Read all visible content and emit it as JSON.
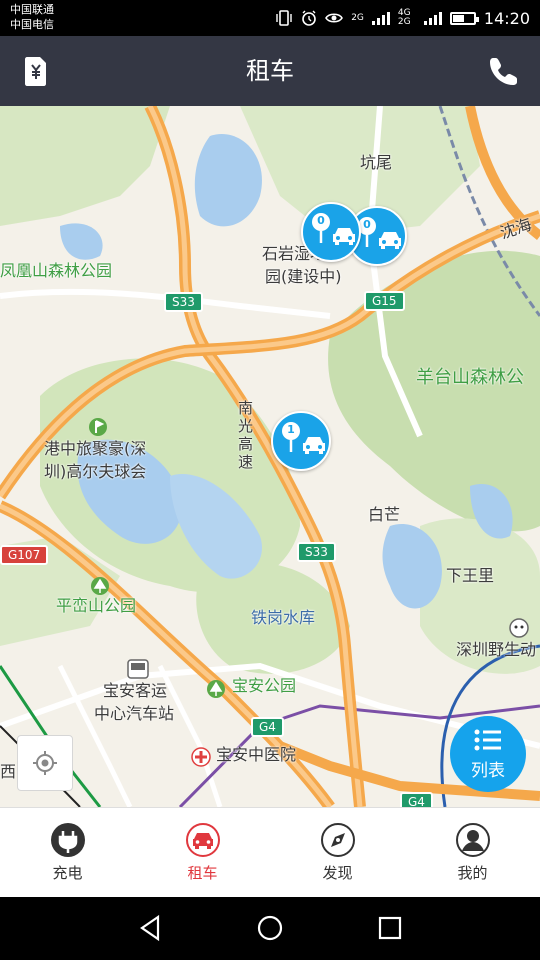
{
  "status_bar": {
    "carrier_1": "中国联通",
    "carrier_2": "中国电信",
    "network_1": "2G",
    "network_2": "4G 2G",
    "time": "14:20",
    "battery_level": 0.5
  },
  "header": {
    "title": "租车",
    "left_icon": "yuan-receipt-icon",
    "right_icon": "phone-icon"
  },
  "map": {
    "labels": {
      "kengwei": "坑尾",
      "shiyan_line1": "石岩湿地公",
      "shiyan_line2": "园(建设中)",
      "fenghuang": "凤凰山森林公园",
      "shenhai": "沈海",
      "yangtaishan": "羊台山森林公",
      "nanguang": "南光高速",
      "gangzhong_line1": "港中旅聚豪(深",
      "gangzhong_line2": "圳)高尔夫球会",
      "baimang": "白芒",
      "xiawangli": "下王里",
      "pingluan": "平峦山公园",
      "tiegang": "铁岗水库",
      "shenzhen_wild": "深圳野生动",
      "baoan_bus_line1": "宝安客运",
      "baoan_bus_line2": "中心汽车站",
      "baoan_park": "宝安公园",
      "baoan_hospital": "宝安中医院",
      "xi": "西"
    },
    "road_badges": {
      "s33_a": "S33",
      "s33_b": "S33",
      "g15": "G15",
      "g107": "G107",
      "g4_a": "G4",
      "g4_b": "G4"
    },
    "markers": [
      {
        "count": "0"
      },
      {
        "count": "0"
      },
      {
        "count": "1"
      }
    ],
    "list_button": "列表",
    "colors": {
      "marker": "#1aa3e8",
      "expressway": "#f5a84b",
      "green_area": "#c9dfb0",
      "water": "#a9cdee"
    }
  },
  "tabs": [
    {
      "label": "充电",
      "icon": "plug-icon",
      "active": false
    },
    {
      "label": "租车",
      "icon": "car-icon",
      "active": true
    },
    {
      "label": "发现",
      "icon": "compass-icon",
      "active": false
    },
    {
      "label": "我的",
      "icon": "user-icon",
      "active": false
    }
  ],
  "accent_color": "#e0383e"
}
